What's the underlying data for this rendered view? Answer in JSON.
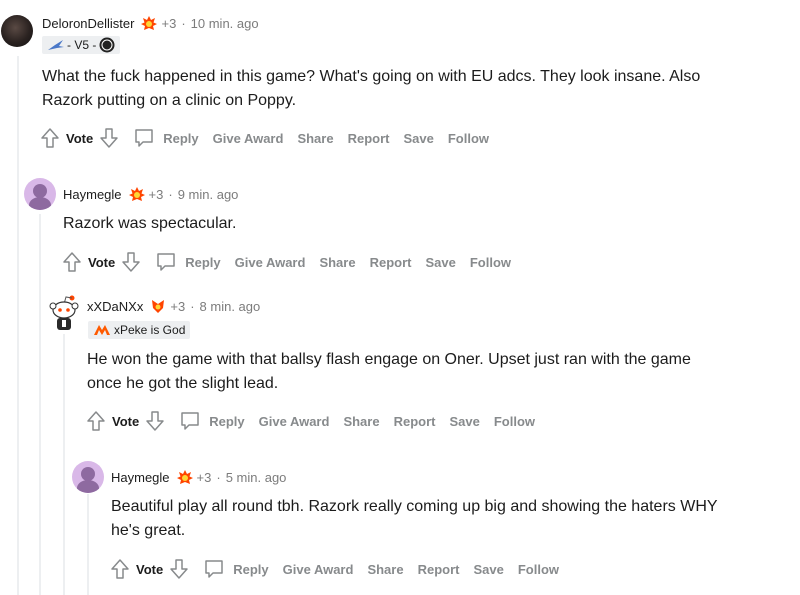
{
  "comments": [
    {
      "user": "DeloronDellister",
      "karma": "+3",
      "dot": "·",
      "time": "10 min. ago",
      "flair": "- V5 -",
      "body_lines": [
        "What the fuck happened in this game? What's going on with EU adcs. They look insane. Also",
        "Razork putting on a clinic on Poppy."
      ]
    },
    {
      "user": "Haymegle",
      "karma": "+3",
      "dot": "·",
      "time": "9 min. ago",
      "body_lines": [
        "Razork was spectacular."
      ]
    },
    {
      "user": "xXDaNXx",
      "karma": "+3",
      "dot": "·",
      "time": "8 min. ago",
      "flair": "xPeke is God",
      "body_lines": [
        "He won the game with that ballsy flash engage on Oner. Upset just ran with the game",
        "once he got the slight lead."
      ]
    },
    {
      "user": "Haymegle",
      "karma": "+3",
      "dot": "·",
      "time": "5 min. ago",
      "body_lines": [
        "Beautiful play all round tbh. Razork really coming up big and showing the haters WHY",
        "he's great."
      ]
    }
  ],
  "actions": {
    "vote": "Vote",
    "reply": "Reply",
    "give_award": "Give Award",
    "share": "Share",
    "report": "Report",
    "save": "Save",
    "follow": "Follow"
  },
  "colors": {
    "award_orange": "#ff4500",
    "thread_line": "#edeff1",
    "muted": "#878a8c"
  },
  "icons": [
    "upvote-icon",
    "downvote-icon",
    "comment-icon",
    "award-icon",
    "team-logo-icon"
  ]
}
